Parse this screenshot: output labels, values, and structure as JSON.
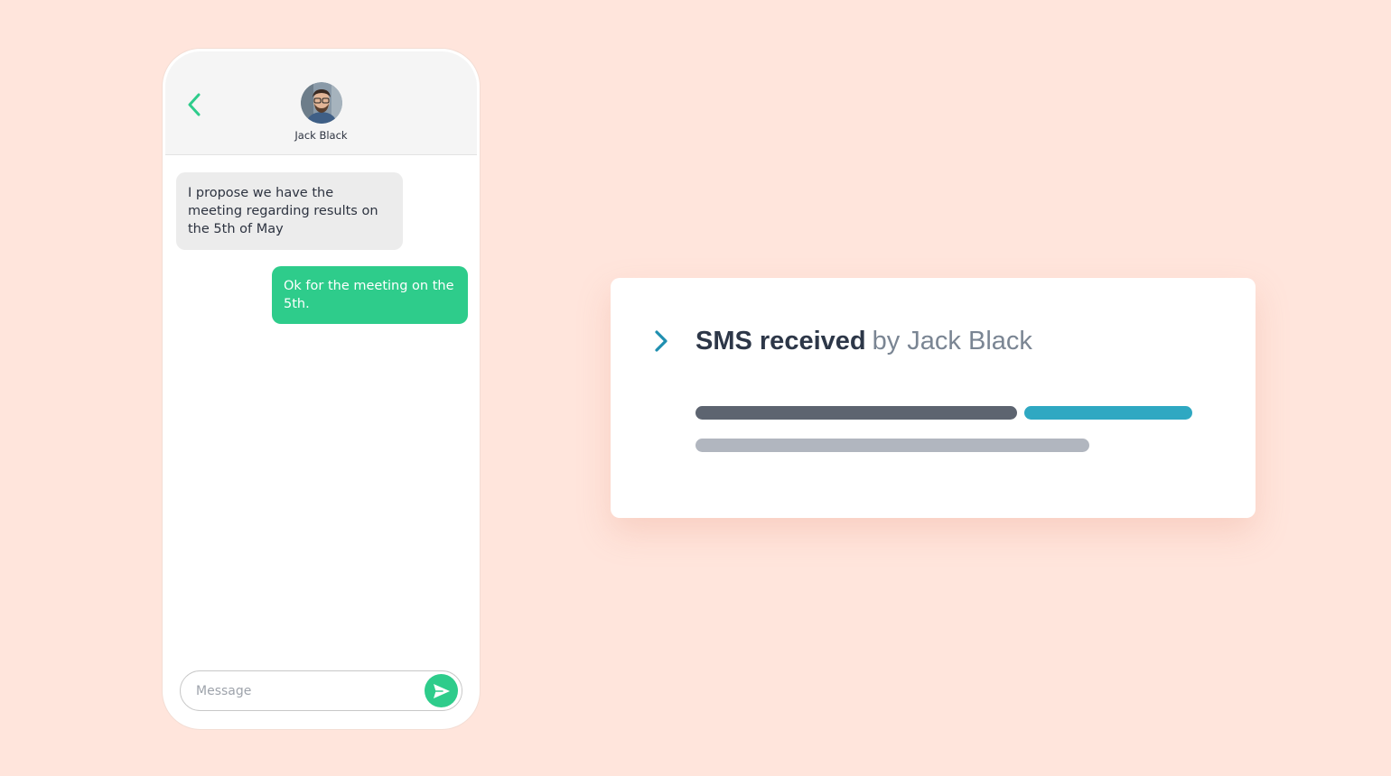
{
  "phone": {
    "contact_name": "Jack Black",
    "back_icon": "chevron-left-icon",
    "send_icon": "send-icon",
    "accent_color": "#2ecc8b",
    "messages": [
      {
        "direction": "incoming",
        "text": "I propose we have the meeting regarding results on the 5th of May"
      },
      {
        "direction": "outgoing",
        "text": "Ok for the meeting on the 5th."
      }
    ],
    "composer": {
      "placeholder": "Message",
      "value": ""
    }
  },
  "card": {
    "title": "SMS received",
    "subtitle": "by Jack Black",
    "chevron_icon": "chevron-right-icon",
    "accent_color": "#1f8fb0",
    "bar_colors": [
      "#5d6470",
      "#2fa8c2",
      "#b1b6bf"
    ]
  }
}
